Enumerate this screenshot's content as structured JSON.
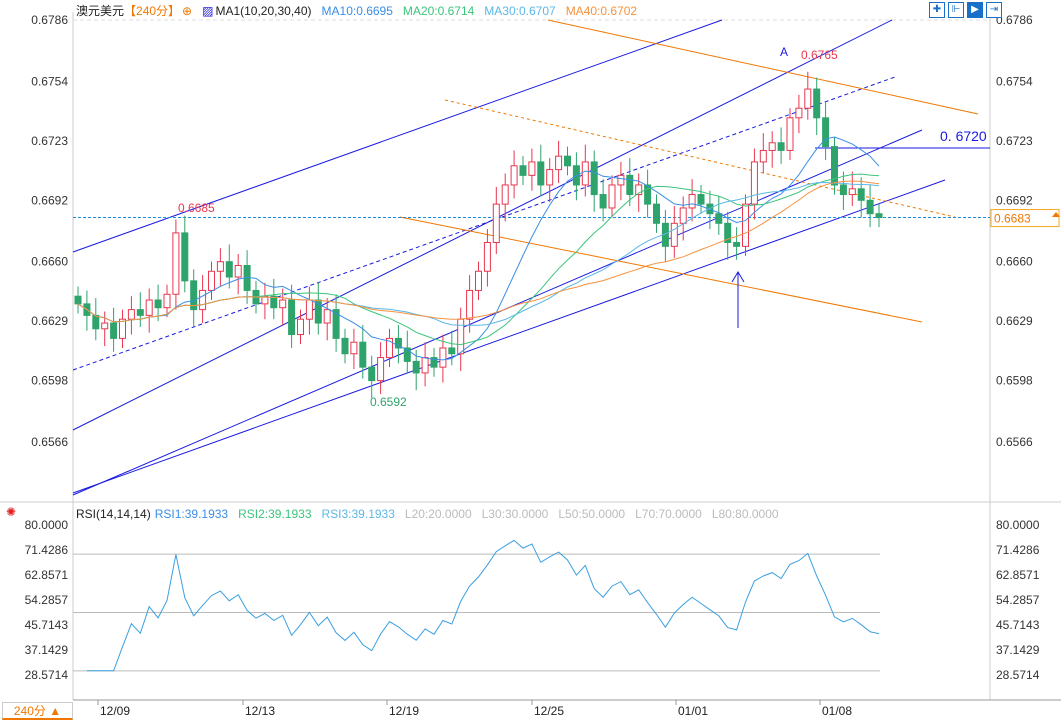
{
  "header": {
    "symbol": "澳元美元",
    "period": "【240分】",
    "indicator": "MA1(10,20,30,40)",
    "ma10": "MA10:0.6695",
    "ma20": "MA20:0.6714",
    "ma30": "MA30:0.6707",
    "ma40": "MA40:0.6702"
  },
  "rsi_header": {
    "name": "RSI(14,14,14)",
    "rsi1": "RSI1:39.1933",
    "rsi2": "RSI2:39.1933",
    "rsi3": "RSI3:39.1933",
    "l20": "L20:20.0000",
    "l30": "L30:30.0000",
    "l50": "L50:50.0000",
    "l70": "L70:70.0000",
    "l80": "L80:80.0000"
  },
  "toolbar": {
    "icons": [
      "crosshair-icon",
      "range-icon",
      "play-icon",
      "move-right-icon"
    ]
  },
  "period_button": "240分 ▲",
  "colors": {
    "up": "#e8374f",
    "down": "#2ea36b",
    "ma10": "#3a8ee6",
    "ma20": "#3cc47c",
    "ma30": "#5bb8e8",
    "ma40": "#f5923e",
    "channel": "#1a1ae0",
    "orange_channel": "#f07800",
    "rsi": "#3aa0e0"
  },
  "chart_data": [
    {
      "type": "candlestick",
      "title": "澳元美元【240分】",
      "ylim": [
        0.6535,
        0.68
      ],
      "y_ticks": [
        "0.6786",
        "0.6754",
        "0.6723",
        "0.6692",
        "0.6660",
        "0.6629",
        "0.6598",
        "0.6566"
      ],
      "x_ticks": [
        "12/09",
        "12/13",
        "12/19",
        "12/25",
        "01/01",
        "01/08"
      ],
      "closes": [
        0.6638,
        0.6632,
        0.6625,
        0.6628,
        0.662,
        0.663,
        0.6635,
        0.6632,
        0.664,
        0.6636,
        0.6643,
        0.6675,
        0.665,
        0.6635,
        0.6645,
        0.6655,
        0.666,
        0.6652,
        0.6658,
        0.6645,
        0.6638,
        0.6642,
        0.6636,
        0.664,
        0.6622,
        0.663,
        0.664,
        0.6628,
        0.6635,
        0.662,
        0.6612,
        0.6618,
        0.6605,
        0.6598,
        0.661,
        0.662,
        0.6615,
        0.6608,
        0.6602,
        0.661,
        0.6605,
        0.6615,
        0.6612,
        0.663,
        0.6645,
        0.6655,
        0.667,
        0.669,
        0.67,
        0.671,
        0.6705,
        0.6712,
        0.67,
        0.6708,
        0.6715,
        0.671,
        0.67,
        0.6712,
        0.6695,
        0.6688,
        0.67,
        0.6705,
        0.6695,
        0.67,
        0.669,
        0.668,
        0.6668,
        0.668,
        0.6688,
        0.6695,
        0.669,
        0.6685,
        0.668,
        0.667,
        0.6668,
        0.669,
        0.6712,
        0.6718,
        0.6722,
        0.6718,
        0.6735,
        0.674,
        0.675,
        0.6735,
        0.672,
        0.67,
        0.6695,
        0.6698,
        0.6692,
        0.6685,
        0.6683
      ],
      "moving_averages": [
        10,
        20,
        30,
        40
      ],
      "annotations": {
        "high_label": "0.6765",
        "high_marker": "A",
        "low_label": "0.6592",
        "left_high_label": "0.6685",
        "level_label": "0. 6720",
        "last_price": "0.6683"
      }
    },
    {
      "type": "line",
      "title": "RSI(14,14,14)",
      "ylim": [
        28.5714,
        80
      ],
      "y_ticks": [
        "80.0000",
        "71.4286",
        "62.8571",
        "54.2857",
        "45.7143",
        "37.1429",
        "28.5714"
      ],
      "reference_lines": [
        70,
        50,
        30
      ],
      "last_value": 39.1933
    }
  ]
}
